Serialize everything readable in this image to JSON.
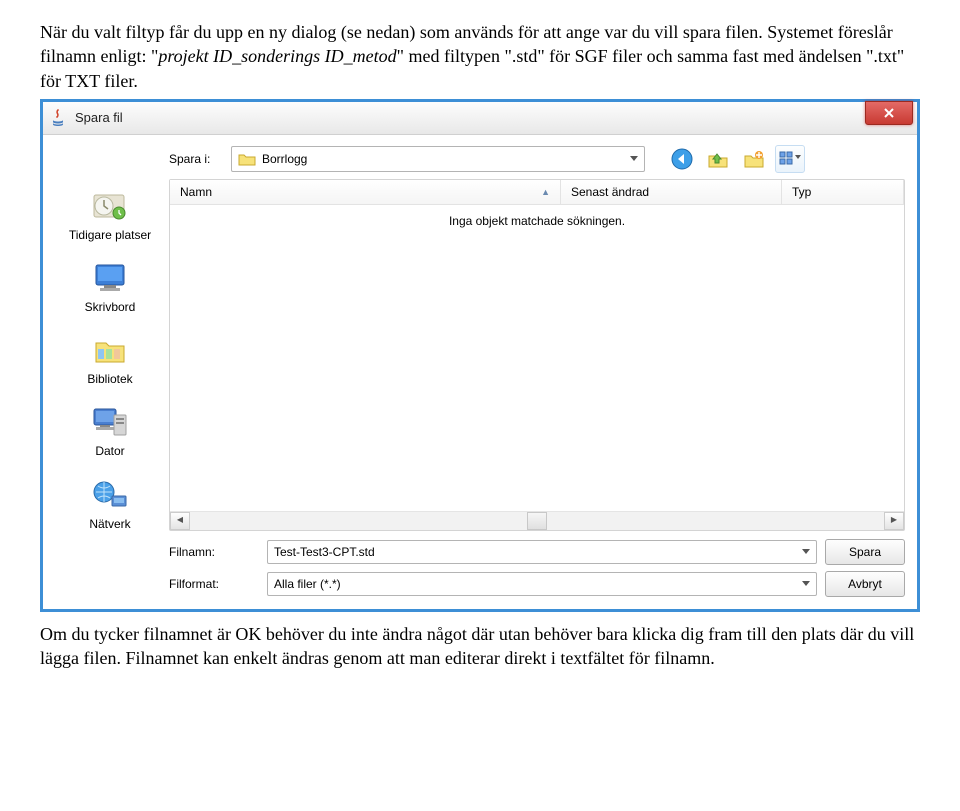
{
  "para1_a": "När du valt filtyp får du upp en ny dialog (se nedan) som används för att ange var du vill spara filen. Systemet föreslår filnamn enligt: \"",
  "para1_b": "projekt ID_sonderings ID_metod",
  "para1_c": "\" med filtypen \".std\" för SGF filer och samma fast med ändelsen \".txt\" för TXT filer.",
  "dialog": {
    "title": "Spara fil",
    "look_in_label": "Spara i:",
    "folder": "Borrlogg",
    "places": {
      "recent": "Tidigare platser",
      "desktop": "Skrivbord",
      "libraries": "Bibliotek",
      "computer": "Dator",
      "network": "Nätverk"
    },
    "cols": {
      "name": "Namn",
      "date": "Senast ändrad",
      "type": "Typ"
    },
    "empty": "Inga objekt matchade sökningen.",
    "filename_label": "Filnamn:",
    "filename_value": "Test-Test3-CPT.std",
    "format_label": "Filformat:",
    "format_value": "Alla filer (*.*)",
    "save": "Spara",
    "cancel": "Avbryt"
  },
  "para2": "Om du tycker filnamnet är OK behöver du inte ändra något där utan behöver bara klicka dig fram till den plats där du vill lägga filen. Filnamnet kan enkelt ändras genom att man editerar direkt i textfältet för filnamn."
}
